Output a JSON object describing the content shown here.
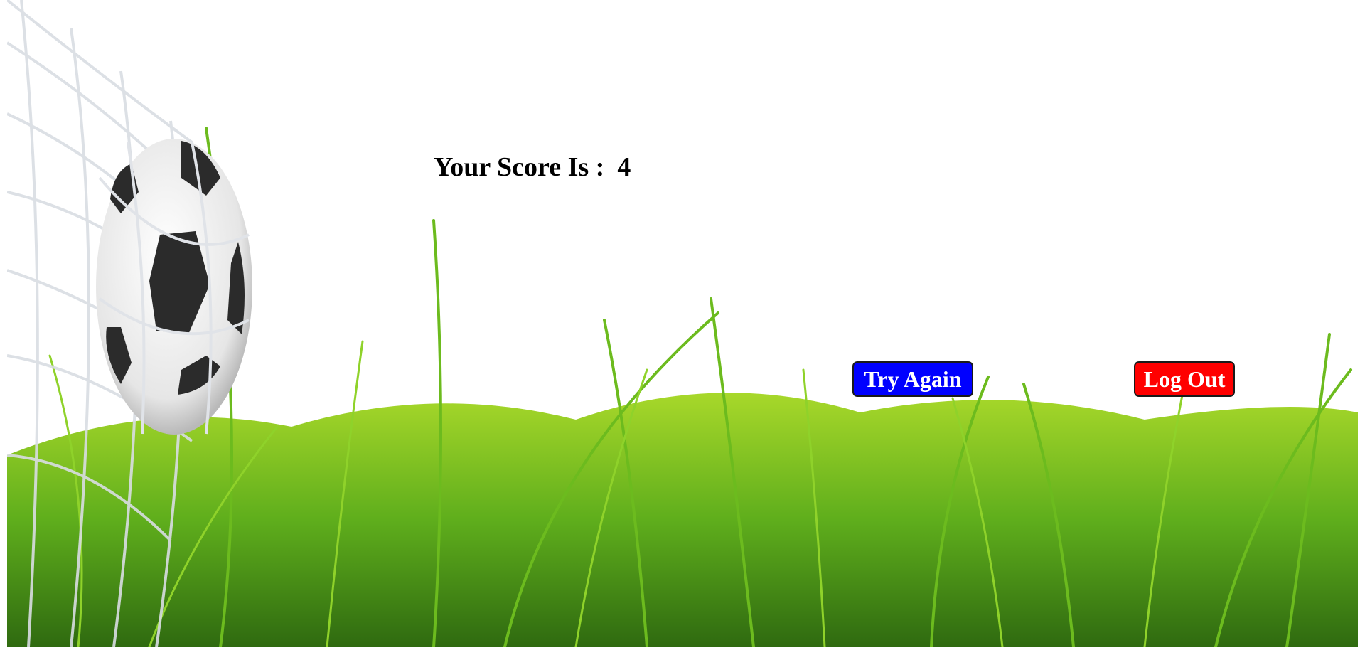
{
  "result": {
    "score_label": "Your Score Is :",
    "score_value": "4"
  },
  "actions": {
    "try_again_label": "Try Again",
    "logout_label": "Log Out"
  },
  "colors": {
    "try_again_bg": "#0000ff",
    "logout_bg": "#ff0000",
    "grass": "#4caf1a"
  },
  "background": {
    "icons": [
      "soccer-ball-icon",
      "goal-net-icon",
      "grass-icon"
    ]
  }
}
